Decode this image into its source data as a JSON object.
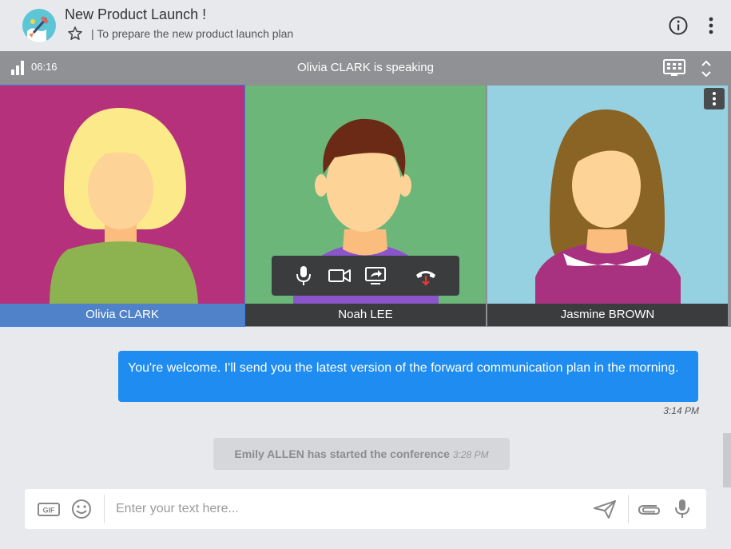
{
  "header": {
    "title": "New Product Launch !",
    "subtitle": "| To prepare the new product launch plan"
  },
  "conference": {
    "timer": "06:16",
    "speaking_text": "Olivia CLARK is speaking"
  },
  "participants": [
    {
      "name": "Olivia CLARK",
      "active": true
    },
    {
      "name": "Noah LEE",
      "active": false
    },
    {
      "name": "Jasmine BROWN",
      "active": false
    }
  ],
  "chat": {
    "messages": [
      {
        "text": "You're welcome. I'll send you the latest version of the forward communication plan in the morning.",
        "time": "3:14 PM"
      }
    ],
    "system": {
      "text": "Emily ALLEN has started the conference",
      "time": "3:28 PM"
    }
  },
  "composer": {
    "placeholder": "Enter your text here...",
    "gif_label": "GIF"
  },
  "colors": {
    "accent": "#1e8cf0",
    "active_tile": "#4f82c9",
    "hangup": "#e53935"
  }
}
